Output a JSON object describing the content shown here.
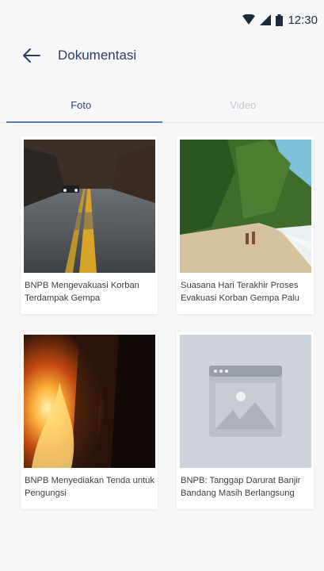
{
  "status": {
    "time": "12:30"
  },
  "app_bar": {
    "title": "Dokumentasi"
  },
  "tabs": [
    {
      "label": "Foto",
      "active": true
    },
    {
      "label": "Video",
      "active": false
    }
  ],
  "cards": [
    {
      "caption": "BNPB Mengevakuasi Korban Terdampak Gempa",
      "image": "road-photo"
    },
    {
      "caption": "Suasana Hari Terakhir Proses Evakuasi Korban Gempa Palu",
      "image": "beach-photo"
    },
    {
      "caption": "BNPB Menyediakan Tenda untuk Pengungsi",
      "image": "fire-photo"
    },
    {
      "caption": "BNPB: Tanggap Darurat Banjir Bandang Masih Berlangsung",
      "image": "image-placeholder-icon"
    }
  ],
  "colors": {
    "title": "#2f3e66",
    "tab_active": "#2f4a7a",
    "tab_indicator": "#5a78b5",
    "tab_inactive": "#c3c7cf"
  }
}
